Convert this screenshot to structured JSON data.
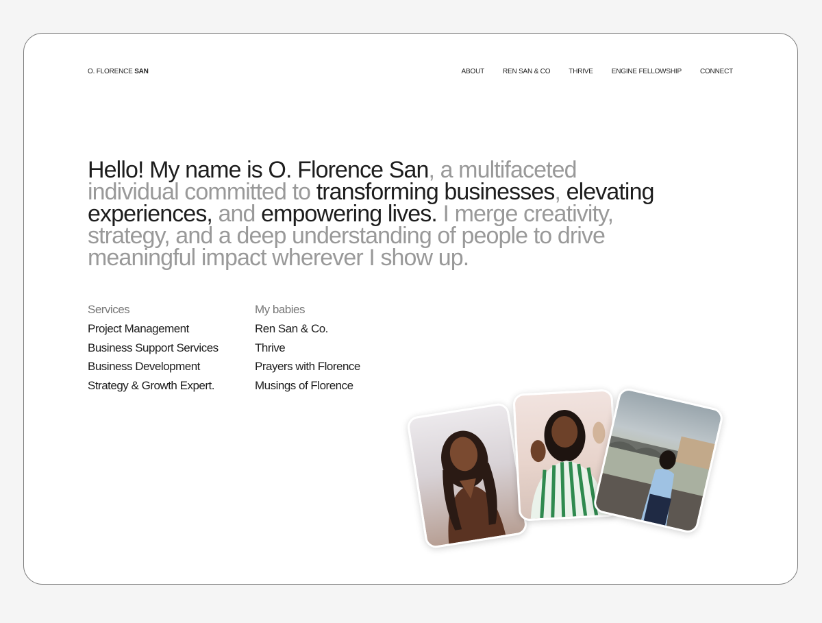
{
  "brand": {
    "first": "O. FLORENCE",
    "last": "SAN"
  },
  "nav": [
    "ABOUT",
    "REN SAN & CO",
    "THRIVE",
    "ENGINE FELLOWSHIP",
    "CONNECT"
  ],
  "hero": [
    {
      "t": "Hello! My name is O. Florence San",
      "dark": true
    },
    {
      "t": ", a multifaceted individual committed to ",
      "dark": false
    },
    {
      "t": "transforming businesses",
      "dark": true
    },
    {
      "t": ", ",
      "dark": false
    },
    {
      "t": "elevating experiences,",
      "dark": true
    },
    {
      "t": " and ",
      "dark": false
    },
    {
      "t": "empowering lives.",
      "dark": true
    },
    {
      "t": " I merge creativity, strategy, and a deep understanding of people to drive meaningful impact wherever I show up.",
      "dark": false
    }
  ],
  "services": {
    "heading": "Services",
    "items": [
      "Project Management",
      "Business Support Services",
      "Business Development",
      "Strategy & Growth Expert."
    ]
  },
  "babies": {
    "heading": "My babies",
    "items": [
      "Ren San & Co.",
      "Thrive",
      "Prayers with Florence",
      "Musings of Florence"
    ]
  },
  "photos": [
    "portrait-brown-dress",
    "portrait-green-stripes-waving",
    "portrait-bridge-river"
  ]
}
